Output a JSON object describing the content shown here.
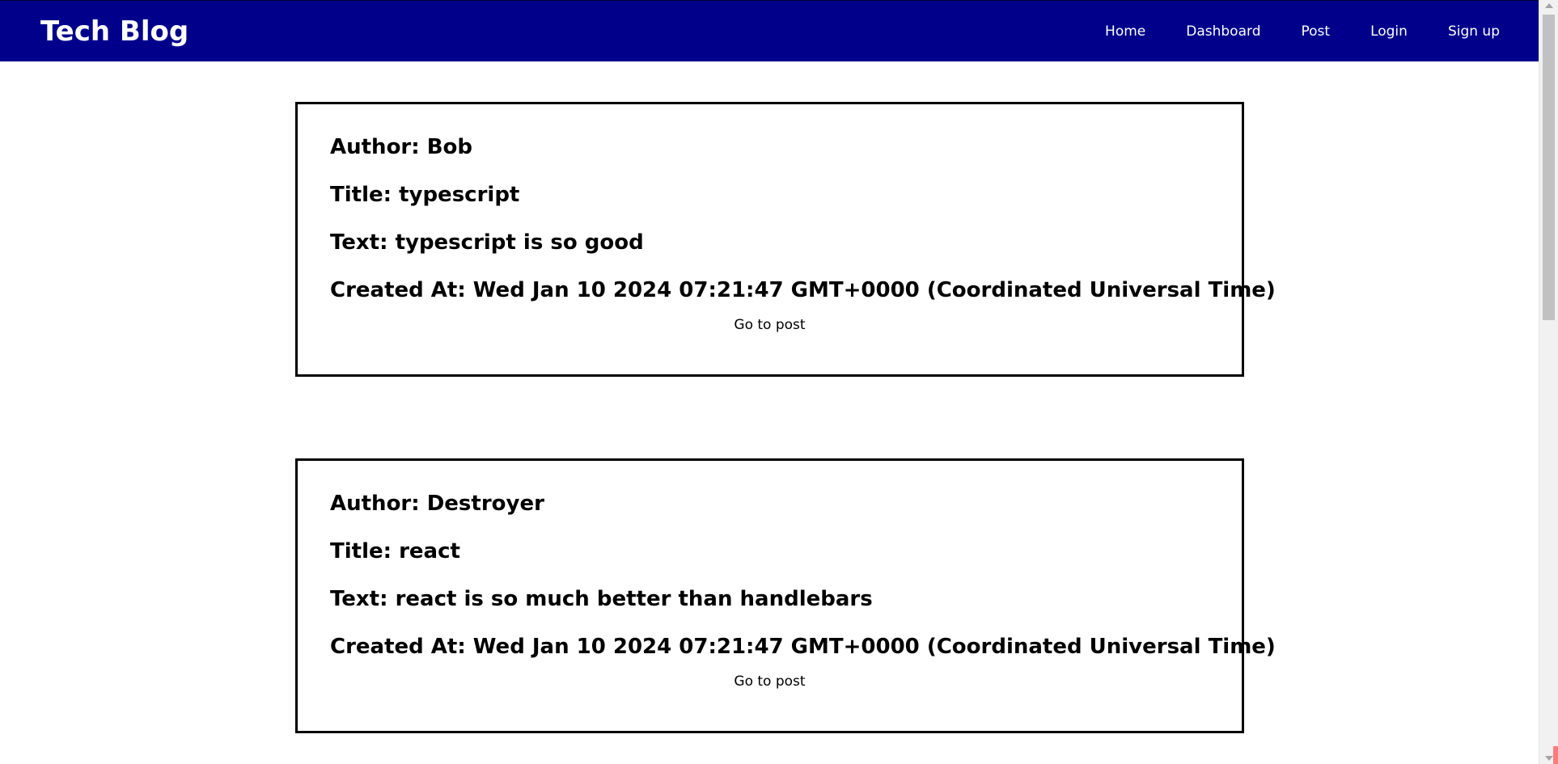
{
  "header": {
    "brand": "Tech Blog",
    "nav": [
      {
        "label": "Home"
      },
      {
        "label": "Dashboard"
      },
      {
        "label": "Post"
      },
      {
        "label": "Login"
      },
      {
        "label": "Sign up"
      }
    ]
  },
  "posts": [
    {
      "author": "Author: Bob",
      "title": "Title: typescript",
      "text": "Text: typescript is so good",
      "created": "Created At: Wed Jan 10 2024 07:21:47 GMT+0000 (Coordinated Universal Time)",
      "link_label": "Go to post"
    },
    {
      "author": "Author: Destroyer",
      "title": "Title: react",
      "text": "Text: react is so much better than handlebars",
      "created": "Created At: Wed Jan 10 2024 07:21:47 GMT+0000 (Coordinated Universal Time)",
      "link_label": "Go to post"
    }
  ],
  "colors": {
    "navbar_bg": "#00008b",
    "nav_text": "#ffffff",
    "card_border": "#000000"
  }
}
